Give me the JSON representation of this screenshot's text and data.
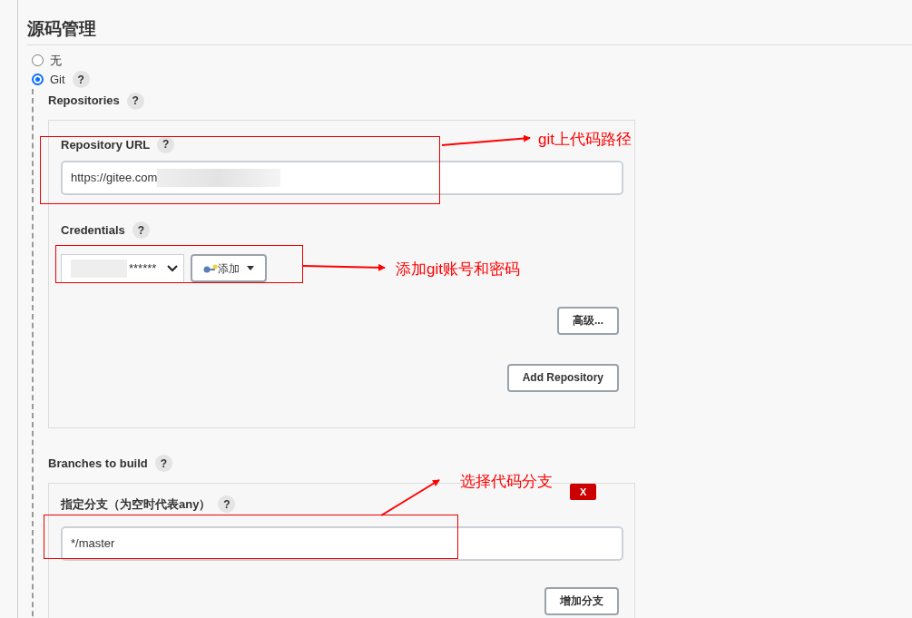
{
  "section": {
    "title": "源码管理"
  },
  "scm_options": [
    {
      "label": "无",
      "selected": false
    },
    {
      "label": "Git",
      "selected": true,
      "help": "?"
    }
  ],
  "repositories": {
    "label": "Repositories",
    "help": "?",
    "url_label": "Repository URL",
    "url_help": "?",
    "url_value": "https://gitee.com",
    "credentials_label": "Credentials",
    "credentials_help": "?",
    "credentials_value": "******",
    "add_button": "添加",
    "advanced_button": "高级...",
    "add_repository_button": "Add Repository"
  },
  "branches": {
    "label": "Branches to build",
    "help": "?",
    "branch_label": "指定分支（为空时代表any）",
    "branch_help": "?",
    "branch_value": "*/master",
    "delete_button": "X",
    "add_branch_button": "增加分支"
  },
  "annotations": [
    {
      "text": "git上代码路径"
    },
    {
      "text": "添加git账号和密码"
    },
    {
      "text": "选择代码分支"
    }
  ]
}
